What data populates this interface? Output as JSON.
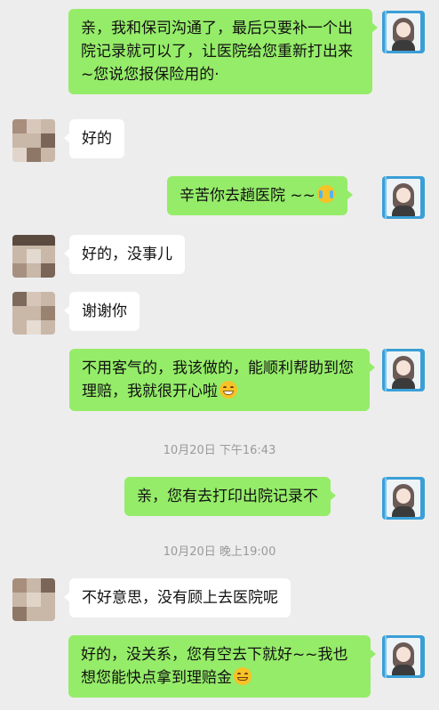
{
  "messages": [
    {
      "id": "m1",
      "text": "亲，我和保司沟通了，最后只要补一个出院记录就可以了，让医院给您重新打出来~您说您报保险用的·"
    },
    {
      "id": "m2",
      "text": "好的"
    },
    {
      "id": "m3",
      "text": "辛苦你去趟医院 ~~",
      "emoji": "crying-face-emoji"
    },
    {
      "id": "m4",
      "text": "好的，没事儿"
    },
    {
      "id": "m5",
      "text": "谢谢你"
    },
    {
      "id": "m6",
      "text": "不用客气的，我该做的，能顺利帮助到您理赔，我就很开心啦",
      "emoji": "grinning-face-emoji"
    },
    {
      "id": "m7",
      "text": "亲，您有去打印出院记录不"
    },
    {
      "id": "m8",
      "text": "不好意思，没有顾上去医院呢"
    },
    {
      "id": "m9",
      "text": "好的，没关系，您有空去下就好~~我也想您能快点拿到理赔金",
      "emoji": "smiling-face-emoji"
    }
  ],
  "timestamps": {
    "t1": "10月20日 下午16:43",
    "t2": "10月20日 晚上19:00"
  },
  "colors": {
    "background": "#ededed",
    "my_bubble": "#95ec69",
    "their_bubble": "#ffffff"
  }
}
